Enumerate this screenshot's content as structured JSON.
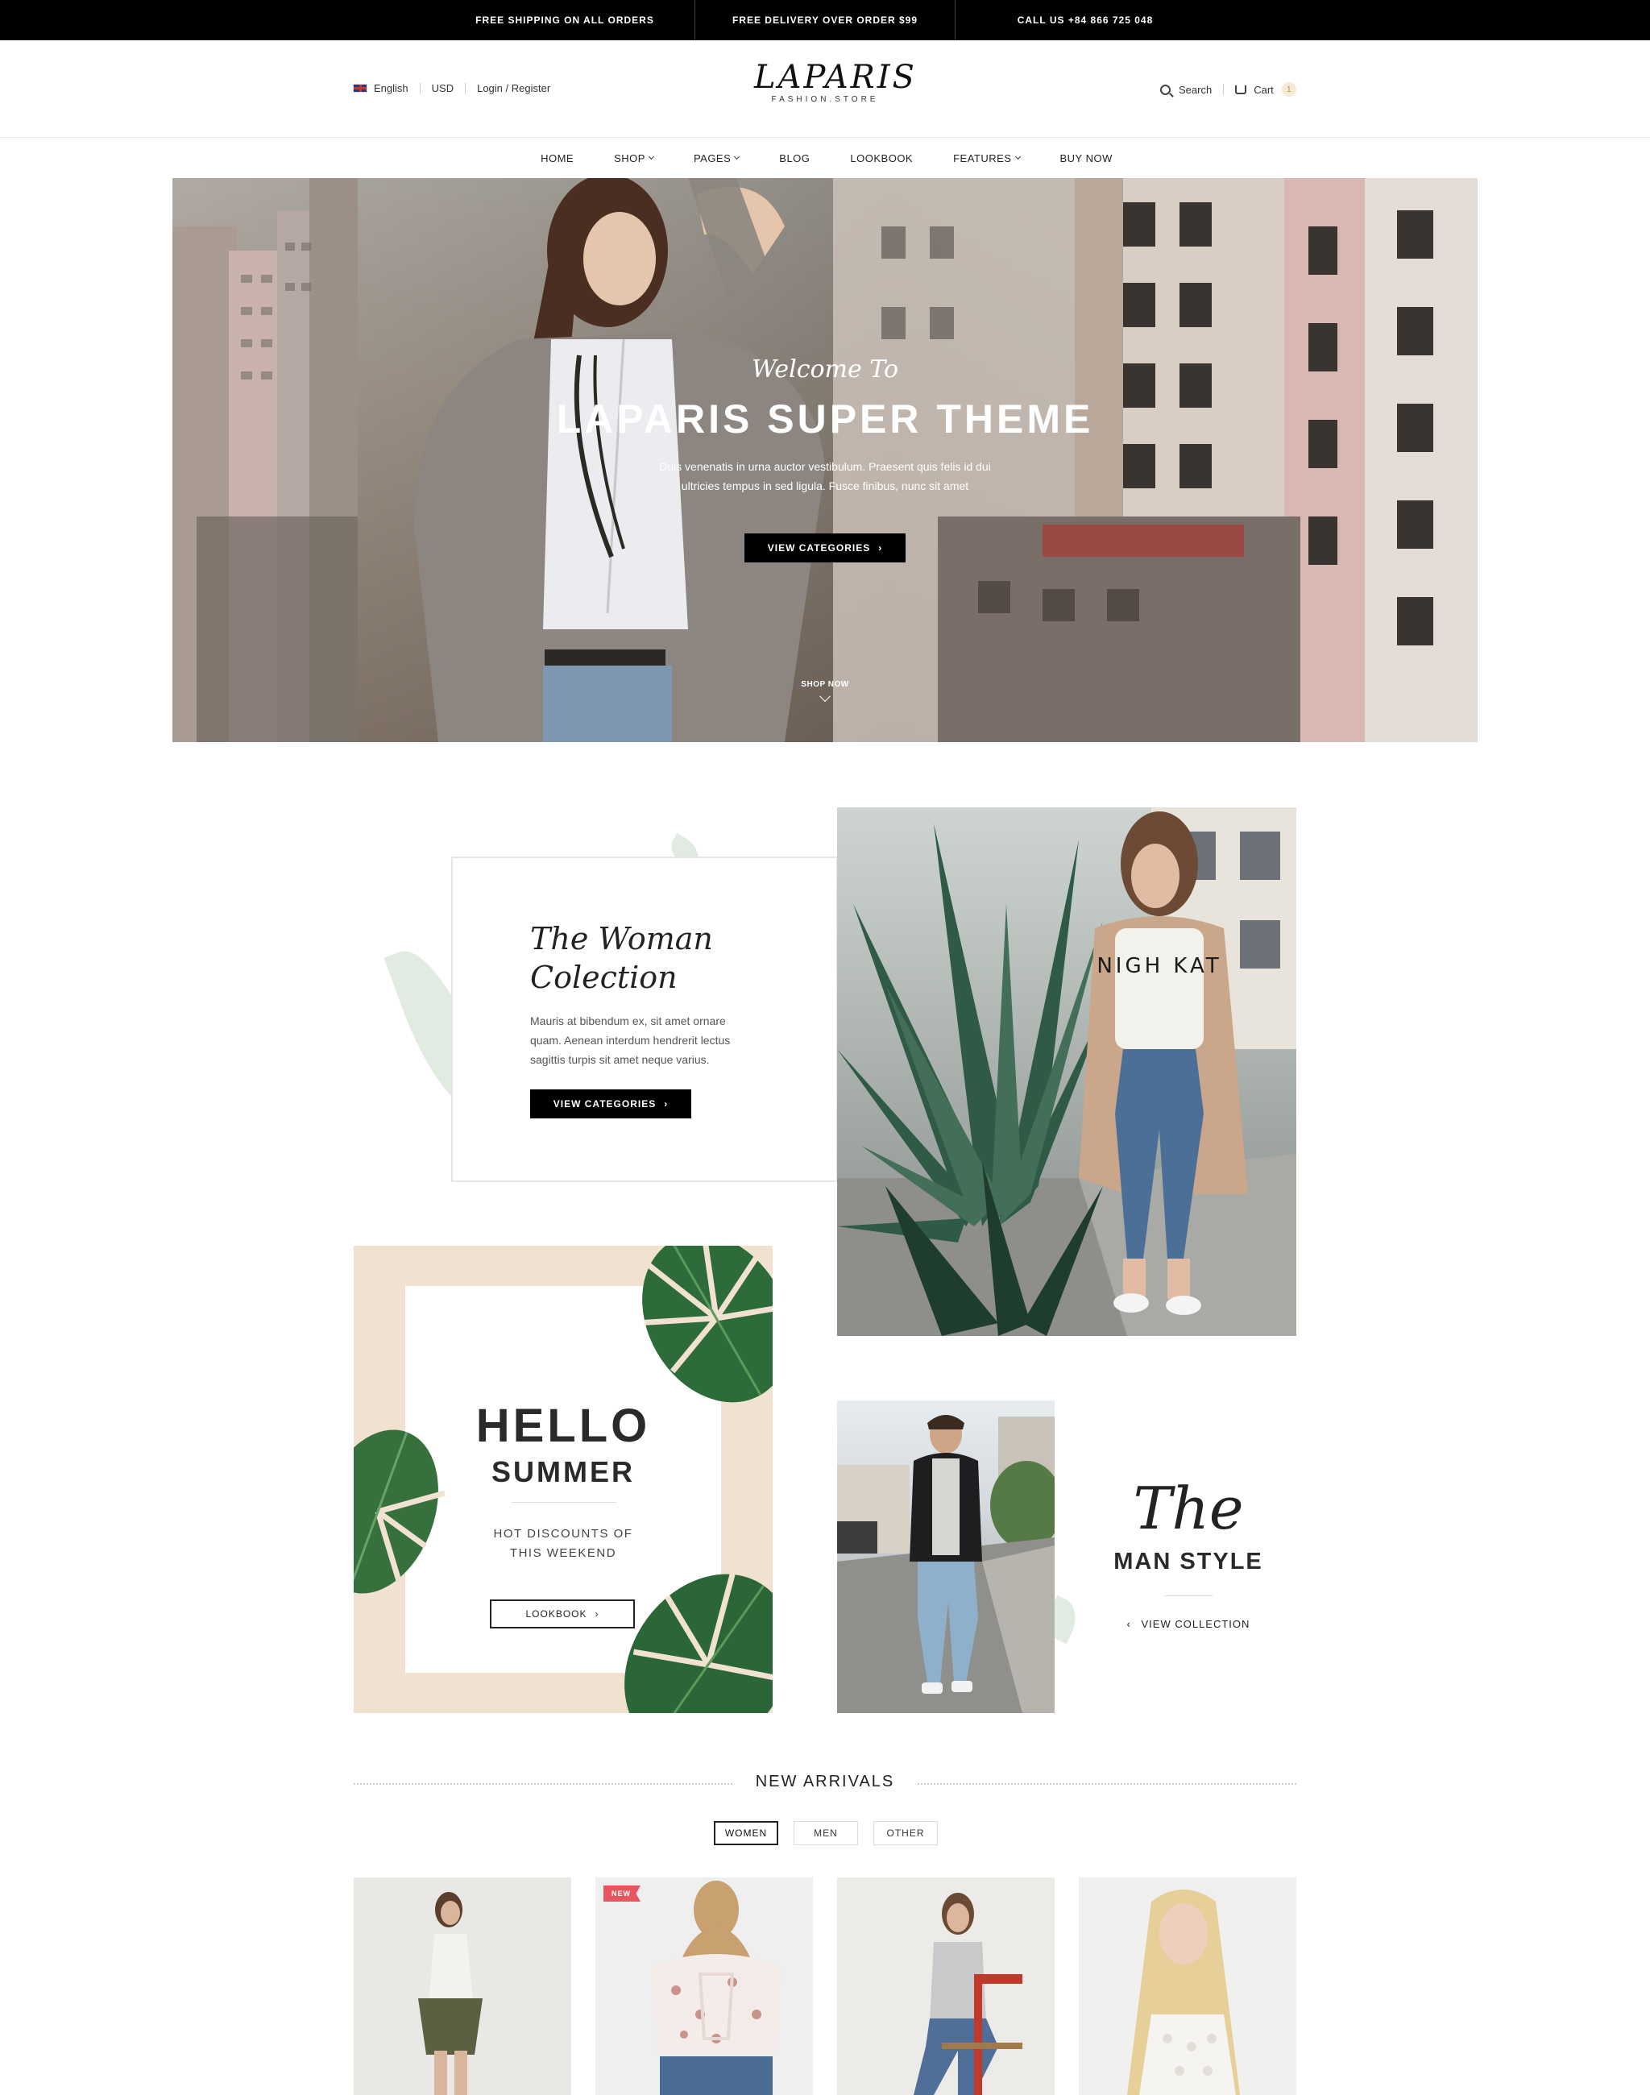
{
  "topbar": {
    "items": [
      "FREE SHIPPING ON ALL ORDERS",
      "FREE DELIVERY OVER ORDER $99",
      "CALL US +84 866 725 048"
    ]
  },
  "header": {
    "language": "English",
    "currency": "USD",
    "login": "Login / Register",
    "logo_main": "LAPARIS",
    "logo_sub": "FASHION.STORE",
    "search": "Search",
    "cart": "Cart",
    "cart_count": "1"
  },
  "nav": {
    "items": [
      {
        "label": "HOME",
        "dropdown": false
      },
      {
        "label": "SHOP",
        "dropdown": true
      },
      {
        "label": "PAGES",
        "dropdown": true
      },
      {
        "label": "BLOG",
        "dropdown": false
      },
      {
        "label": "LOOKBOOK",
        "dropdown": false
      },
      {
        "label": "FEATURES",
        "dropdown": true
      },
      {
        "label": "BUY NOW",
        "dropdown": false
      }
    ]
  },
  "hero": {
    "welcome": "Welcome To",
    "title": "LAPARIS SUPER THEME",
    "description": "Duis venenatis in urna auctor vestibulum. Praesent quis felis id dui ultricies tempus in sed ligula. Fusce finibus, nunc sit amet",
    "button": "VIEW CATEGORIES",
    "shop_now": "SHOP NOW"
  },
  "woman": {
    "title": "The Woman Colection",
    "description": "Mauris at bibendum ex, sit amet ornare quam. Aenean interdum hendrerit lectus sagittis turpis sit amet neque varius.",
    "button": "VIEW CATEGORIES",
    "shirt_text": "NIGH KAT"
  },
  "summer": {
    "hello": "HELLO",
    "sub": "SUMMER",
    "description": "HOT DISCOUNTS OF THIS WEEKEND",
    "button": "LOOKBOOK"
  },
  "man": {
    "the": "The",
    "title": "MAN STYLE",
    "link": "VIEW COLLECTION"
  },
  "new_arrivals": {
    "title": "NEW ARRIVALS",
    "tabs": [
      "WOMEN",
      "MEN",
      "OTHER"
    ],
    "active_tab": "WOMEN",
    "products": [
      {
        "badge": ""
      },
      {
        "badge": "NEW"
      },
      {
        "badge": ""
      },
      {
        "badge": ""
      }
    ]
  },
  "colors": {
    "topbar_bg": "#000000",
    "accent_badge": "#e9555f",
    "summer_bg": "#f1e1d1",
    "cart_badge_bg": "#f5ead4"
  }
}
